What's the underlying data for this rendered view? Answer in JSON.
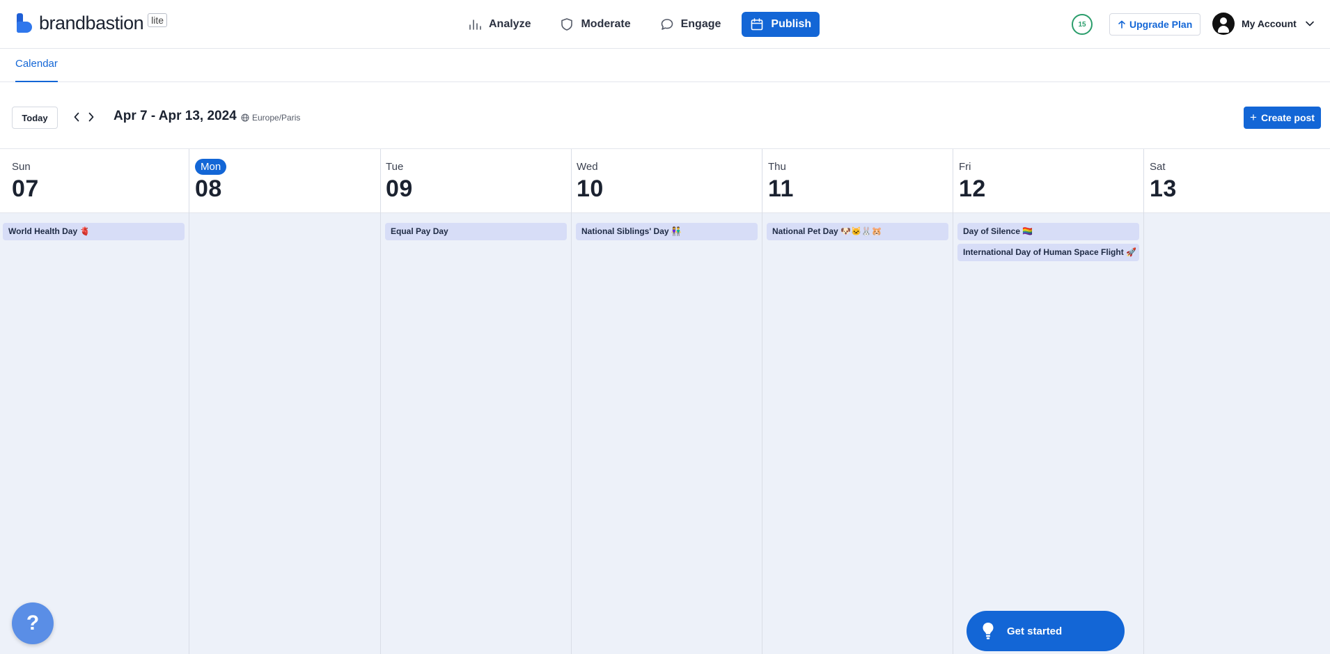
{
  "brand": {
    "name": "brandbastion",
    "badge": "lite"
  },
  "nav": [
    {
      "label": "Analyze",
      "icon": "bar-chart-icon"
    },
    {
      "label": "Moderate",
      "icon": "shield-icon"
    },
    {
      "label": "Engage",
      "icon": "chat-bubble-icon"
    },
    {
      "label": "Publish",
      "icon": "calendar-icon",
      "active": true
    }
  ],
  "header": {
    "credits": "15",
    "upgrade_label": "Upgrade Plan",
    "account_label": "My Account"
  },
  "subnav": {
    "tab": "Calendar"
  },
  "toolbar": {
    "today_label": "Today",
    "date_range": "Apr 7 - Apr 13, 2024",
    "timezone": "Europe/Paris",
    "create_label": "Create post"
  },
  "days": [
    {
      "dow": "Sun",
      "date": "07",
      "events": [
        "World Health Day 🫀"
      ]
    },
    {
      "dow": "Mon",
      "date": "08",
      "today": true,
      "events": []
    },
    {
      "dow": "Tue",
      "date": "09",
      "events": [
        "Equal Pay Day"
      ]
    },
    {
      "dow": "Wed",
      "date": "10",
      "events": [
        "National Siblings' Day 👫"
      ]
    },
    {
      "dow": "Thu",
      "date": "11",
      "events": [
        "National Pet Day 🐶🐱🐰🐹"
      ]
    },
    {
      "dow": "Fri",
      "date": "12",
      "events": [
        "Day of Silence 🏳️‍🌈",
        "International Day of Human Space Flight 🚀"
      ]
    },
    {
      "dow": "Sat",
      "date": "13",
      "events": []
    }
  ],
  "help": {
    "label": "?"
  },
  "get_started": {
    "label": "Get started"
  },
  "colors": {
    "primary": "#1366d6",
    "event_bg": "#d7ddf7",
    "calendar_bg": "#edf1f9",
    "credits_ring": "#2a9d6b"
  }
}
